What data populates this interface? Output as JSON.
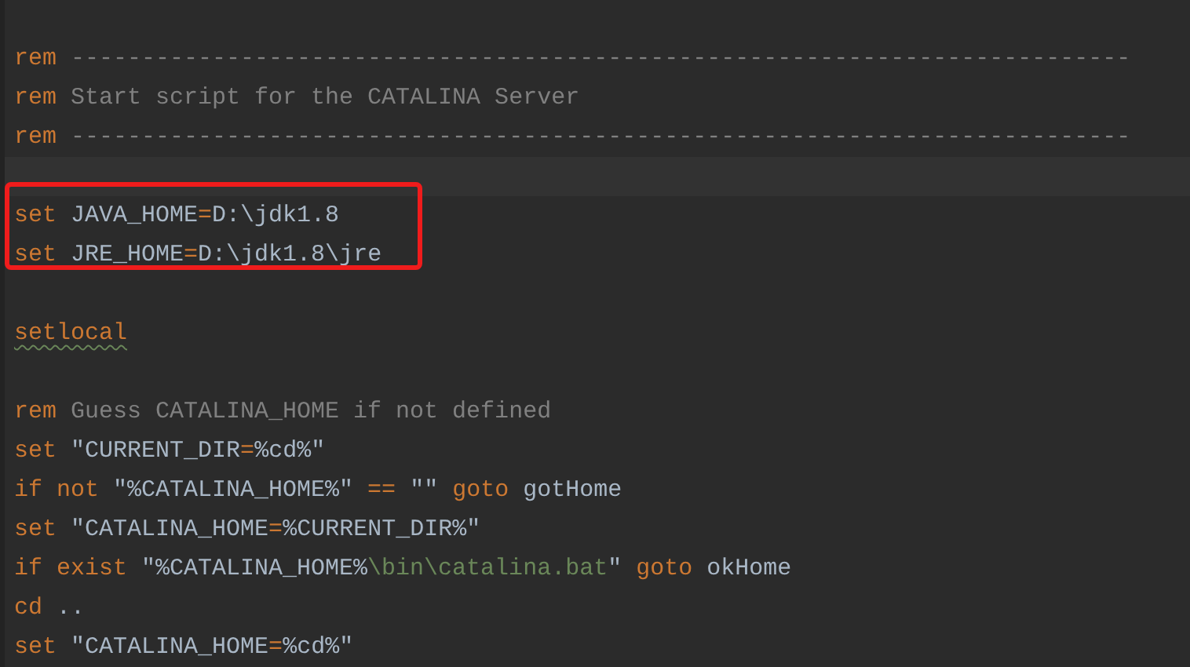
{
  "editor": {
    "lines": [
      {
        "tokens": [
          {
            "kind": "keyword",
            "text": "rem"
          },
          {
            "kind": "comment",
            "text": " ---------------------------------------------------------------------------"
          }
        ]
      },
      {
        "tokens": [
          {
            "kind": "keyword",
            "text": "rem"
          },
          {
            "kind": "comment",
            "text": " Start script for the CATALINA Server"
          }
        ]
      },
      {
        "tokens": [
          {
            "kind": "keyword",
            "text": "rem"
          },
          {
            "kind": "comment",
            "text": " ---------------------------------------------------------------------------"
          }
        ]
      },
      {
        "kind": "blank",
        "current": true
      },
      {
        "boxed": true,
        "tokens": [
          {
            "kind": "keyword",
            "text": "set"
          },
          {
            "kind": "plain",
            "text": " JAVA_HOME"
          },
          {
            "kind": "keyword",
            "text": "="
          },
          {
            "kind": "plain",
            "text": "D:\\jdk1.8"
          }
        ]
      },
      {
        "boxed": true,
        "tokens": [
          {
            "kind": "keyword",
            "text": "set"
          },
          {
            "kind": "plain",
            "text": " JRE_HOME"
          },
          {
            "kind": "keyword",
            "text": "="
          },
          {
            "kind": "plain",
            "text": "D:\\jdk1.8\\jre"
          }
        ]
      },
      {
        "kind": "blank"
      },
      {
        "tokens": [
          {
            "kind": "keyword",
            "text": "setlocal",
            "flagged": true
          }
        ]
      },
      {
        "kind": "blank"
      },
      {
        "tokens": [
          {
            "kind": "keyword",
            "text": "rem"
          },
          {
            "kind": "comment",
            "text": " Guess CATALINA_HOME if not defined"
          }
        ]
      },
      {
        "tokens": [
          {
            "kind": "keyword",
            "text": "set"
          },
          {
            "kind": "plain",
            "text": " \"CURRENT_DIR"
          },
          {
            "kind": "keyword",
            "text": "="
          },
          {
            "kind": "plain",
            "text": "%cd%\""
          }
        ]
      },
      {
        "tokens": [
          {
            "kind": "keyword",
            "text": "if not"
          },
          {
            "kind": "plain",
            "text": " \"%CATALINA_HOME%\" "
          },
          {
            "kind": "keyword",
            "text": "=="
          },
          {
            "kind": "plain",
            "text": " \"\" "
          },
          {
            "kind": "keyword",
            "text": "goto"
          },
          {
            "kind": "plain",
            "text": " gotHome"
          }
        ]
      },
      {
        "tokens": [
          {
            "kind": "keyword",
            "text": "set"
          },
          {
            "kind": "plain",
            "text": " \"CATALINA_HOME"
          },
          {
            "kind": "keyword",
            "text": "="
          },
          {
            "kind": "plain",
            "text": "%CURRENT_DIR%\""
          }
        ]
      },
      {
        "tokens": [
          {
            "kind": "keyword",
            "text": "if exist"
          },
          {
            "kind": "plain",
            "text": " \"%CATALINA_HOME%"
          },
          {
            "kind": "path",
            "text": "\\bin\\catalina.bat"
          },
          {
            "kind": "plain",
            "text": "\" "
          },
          {
            "kind": "keyword",
            "text": "goto"
          },
          {
            "kind": "plain",
            "text": " okHome"
          }
        ]
      },
      {
        "tokens": [
          {
            "kind": "keyword",
            "text": "cd"
          },
          {
            "kind": "plain",
            "text": " .."
          }
        ]
      },
      {
        "tokens": [
          {
            "kind": "keyword",
            "text": "set"
          },
          {
            "kind": "plain",
            "text": " \"CATALINA_HOME"
          },
          {
            "kind": "keyword",
            "text": "="
          },
          {
            "kind": "plain",
            "text": "%cd%\""
          }
        ]
      }
    ]
  }
}
